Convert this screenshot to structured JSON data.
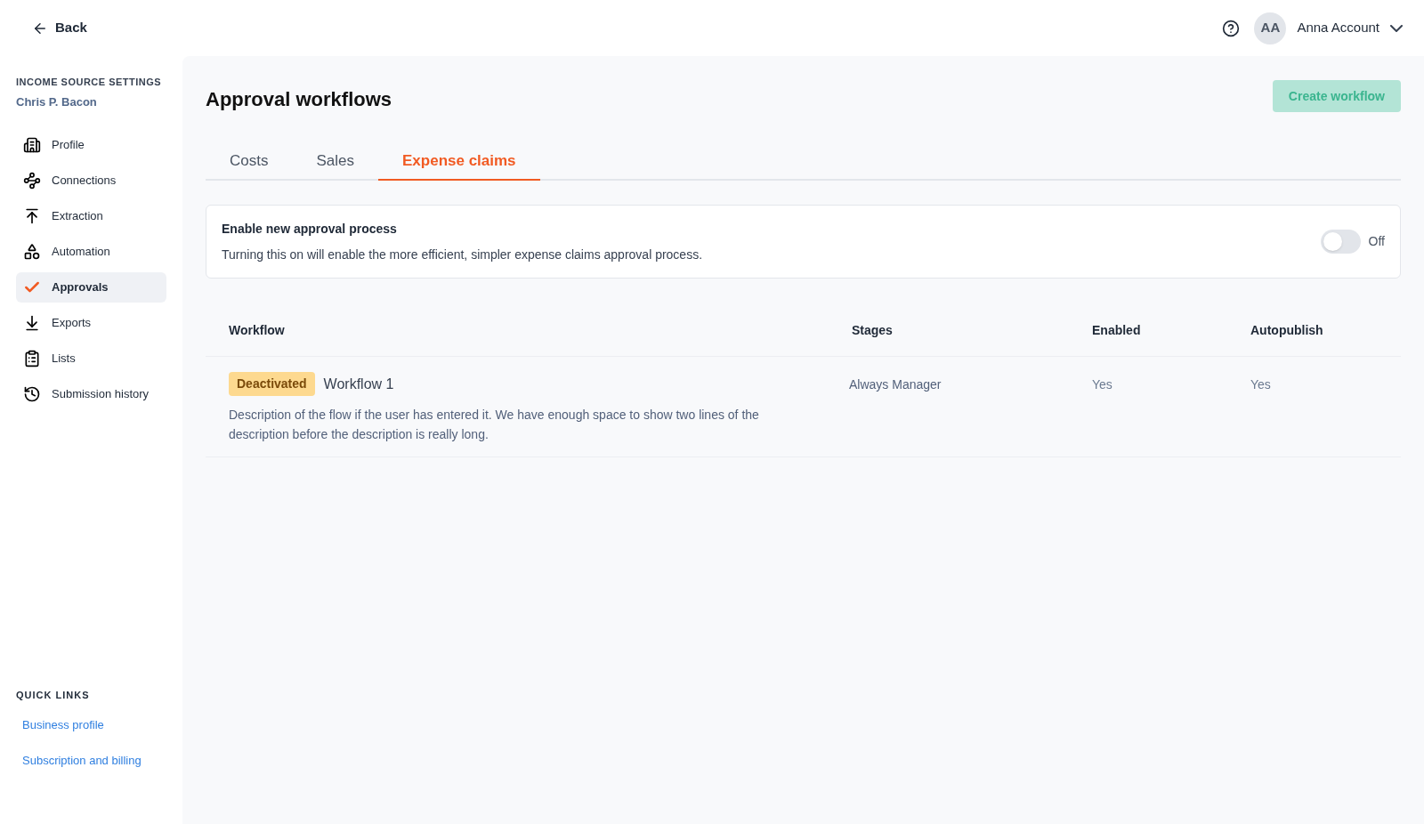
{
  "header": {
    "back": "Back",
    "user": {
      "initials": "AA",
      "name": "Anna Account"
    }
  },
  "sidebar": {
    "section_title": "INCOME SOURCE SETTINGS",
    "subtitle": "Chris P. Bacon",
    "items": [
      {
        "label": "Profile",
        "selected": false
      },
      {
        "label": "Connections",
        "selected": false
      },
      {
        "label": "Extraction",
        "selected": false
      },
      {
        "label": "Automation",
        "selected": false
      },
      {
        "label": "Approvals",
        "selected": true
      },
      {
        "label": "Exports",
        "selected": false
      },
      {
        "label": "Lists",
        "selected": false
      },
      {
        "label": "Submission history",
        "selected": false
      }
    ],
    "quick_links_title": "QUICK LINKS",
    "quick_links": [
      "Business profile",
      "Subscription and billing"
    ]
  },
  "page": {
    "title": "Approval workflows",
    "create_button": "Create workflow",
    "tabs": [
      {
        "label": "Costs",
        "selected": false
      },
      {
        "label": "Sales",
        "selected": false
      },
      {
        "label": "Expense claims",
        "selected": true
      }
    ],
    "setting": {
      "title": "Enable new approval process",
      "description": "Turning this on will enable the more efficient, simpler expense claims approval process.",
      "on": false,
      "state_label": "Off"
    },
    "table": {
      "columns": [
        "Workflow",
        "Stages",
        "Enabled",
        "Autopublish"
      ],
      "rows": [
        {
          "badge": "Deactivated",
          "name": "Workflow 1",
          "description": "Description of the flow if the user has entered it. We have enough space to show two lines of the description before the description is really long.",
          "stages": "Always Manager",
          "enabled": "Yes",
          "autopublish": "Yes"
        }
      ]
    }
  }
}
